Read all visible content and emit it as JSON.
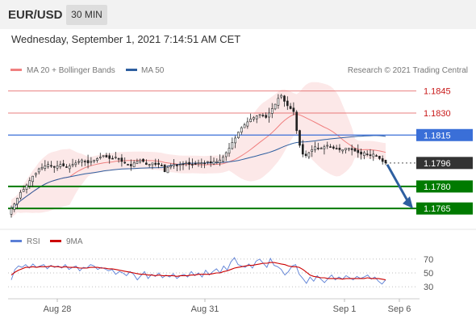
{
  "header": {
    "pair": "EUR/USD",
    "timeframe": "30 MIN",
    "datetime": "Wednesday, September 1, 2021 7:14:51 AM CET"
  },
  "legend": {
    "bollinger": "MA 20 + Bollinger Bands",
    "ma50": "MA 50",
    "credit": "Research © 2021 Trading Central",
    "rsi": "RSI",
    "rsi_ma": "9MA"
  },
  "colors": {
    "bollinger": "#f08080",
    "ma50": "#2e5fa0",
    "resistance": "#e05555",
    "support": "#007a00",
    "current": "#333333",
    "arrow": "#2e5fa0",
    "rsi": "#5b7fd6",
    "rsi_ma": "#cc0000"
  },
  "chart_data": [
    {
      "type": "candlestick",
      "title": "EUR/USD 30 MIN",
      "x_tick_labels": [
        "Aug 28",
        "Aug 31",
        "Sep 1",
        "Sep 6"
      ],
      "ylim": [
        1.1753,
        1.1852
      ],
      "levels": [
        {
          "label": "1.1845",
          "value": 1.1845,
          "kind": "resistance"
        },
        {
          "label": "1.1830",
          "value": 1.183,
          "kind": "resistance"
        },
        {
          "label": "1.1815",
          "value": 1.1815,
          "kind": "pivot"
        },
        {
          "label": "1.1796",
          "value": 1.1796,
          "kind": "current"
        },
        {
          "label": "1.1780",
          "value": 1.178,
          "kind": "support"
        },
        {
          "label": "1.1765",
          "value": 1.1765,
          "kind": "support"
        }
      ],
      "close": [
        1.1765,
        1.1768,
        1.1772,
        1.1776,
        1.1778,
        1.1781,
        1.1784,
        1.1787,
        1.1789,
        1.1792,
        1.1793,
        1.1794,
        1.1795,
        1.1794,
        1.1793,
        1.1794,
        1.1795,
        1.1794,
        1.1793,
        1.1794,
        1.1795,
        1.1796,
        1.1797,
        1.1798,
        1.1797,
        1.1796,
        1.1797,
        1.1798,
        1.1799,
        1.18,
        1.1801,
        1.18,
        1.1799,
        1.1799,
        1.18,
        1.1799,
        1.1797,
        1.1796,
        1.1795,
        1.1794,
        1.1796,
        1.1797,
        1.1798,
        1.1797,
        1.1795,
        1.1795,
        1.1796,
        1.1795,
        1.1795,
        1.1794,
        1.179,
        1.1793,
        1.1794,
        1.1795,
        1.1794,
        1.1795,
        1.1795,
        1.1796,
        1.1795,
        1.1795,
        1.1795,
        1.1796,
        1.1796,
        1.1796,
        1.1797,
        1.1796,
        1.1797,
        1.1797,
        1.1798,
        1.18,
        1.1803,
        1.1806,
        1.181,
        1.1813,
        1.1817,
        1.182,
        1.1822,
        1.1824,
        1.1826,
        1.1827,
        1.1828,
        1.1829,
        1.1828,
        1.1827,
        1.183,
        1.1833,
        1.1836,
        1.184,
        1.1842,
        1.1838,
        1.1835,
        1.1833,
        1.1831,
        1.1818,
        1.1808,
        1.1802,
        1.1801,
        1.1803,
        1.1805,
        1.1807,
        1.1806,
        1.1806,
        1.1807,
        1.1808,
        1.1807,
        1.1806,
        1.1806,
        1.1805,
        1.1805,
        1.1806,
        1.1806,
        1.1805,
        1.1804,
        1.1803,
        1.1802,
        1.1803,
        1.1802,
        1.1801,
        1.1802,
        1.1801,
        1.1799,
        1.1797,
        1.1796
      ]
    },
    {
      "type": "line",
      "title": "RSI",
      "yticks": [
        70,
        50,
        30
      ],
      "ylim": [
        22,
        78
      ],
      "series": [
        {
          "name": "RSI",
          "values": [
            40,
            55,
            60,
            58,
            62,
            57,
            63,
            58,
            60,
            62,
            56,
            61,
            58,
            60,
            57,
            62,
            55,
            58,
            60,
            53,
            58,
            57,
            62,
            60,
            55,
            58,
            56,
            53,
            55,
            48,
            52,
            50,
            46,
            52,
            48,
            40,
            46,
            52,
            42,
            48,
            45,
            50,
            43,
            47,
            44,
            49,
            42,
            46,
            48,
            44,
            52,
            46,
            50,
            44,
            54,
            47,
            52,
            56,
            50,
            60,
            54,
            66,
            72,
            62,
            60,
            58,
            63,
            57,
            67,
            70,
            64,
            58,
            71,
            61,
            59,
            55,
            47,
            52,
            60,
            62,
            48,
            42,
            35,
            44,
            38,
            46,
            41,
            36,
            42,
            47,
            40,
            44,
            41,
            46,
            43,
            40,
            45,
            42,
            44,
            47,
            41,
            44,
            38,
            34,
            40
          ]
        },
        {
          "name": "9MA",
          "values": [
            47,
            51,
            54,
            56,
            58,
            58,
            59,
            58,
            59,
            59,
            59,
            60,
            59,
            59,
            58,
            59,
            58,
            58,
            58,
            57,
            57,
            57,
            58,
            58,
            58,
            57,
            57,
            56,
            56,
            55,
            54,
            53,
            52,
            51,
            50,
            49,
            48,
            48,
            47,
            47,
            46,
            47,
            46,
            46,
            46,
            46,
            45,
            46,
            46,
            46,
            47,
            47,
            48,
            48,
            48,
            48,
            49,
            50,
            50,
            52,
            53,
            55,
            57,
            58,
            59,
            60,
            61,
            61,
            62,
            63,
            64,
            64,
            65,
            65,
            64,
            63,
            62,
            60,
            59,
            59,
            58,
            55,
            51,
            47,
            45,
            44,
            43,
            43,
            42,
            42,
            42,
            42,
            41,
            42,
            42,
            42,
            42,
            42,
            42,
            43,
            42,
            42,
            42,
            41,
            40
          ]
        }
      ]
    }
  ]
}
